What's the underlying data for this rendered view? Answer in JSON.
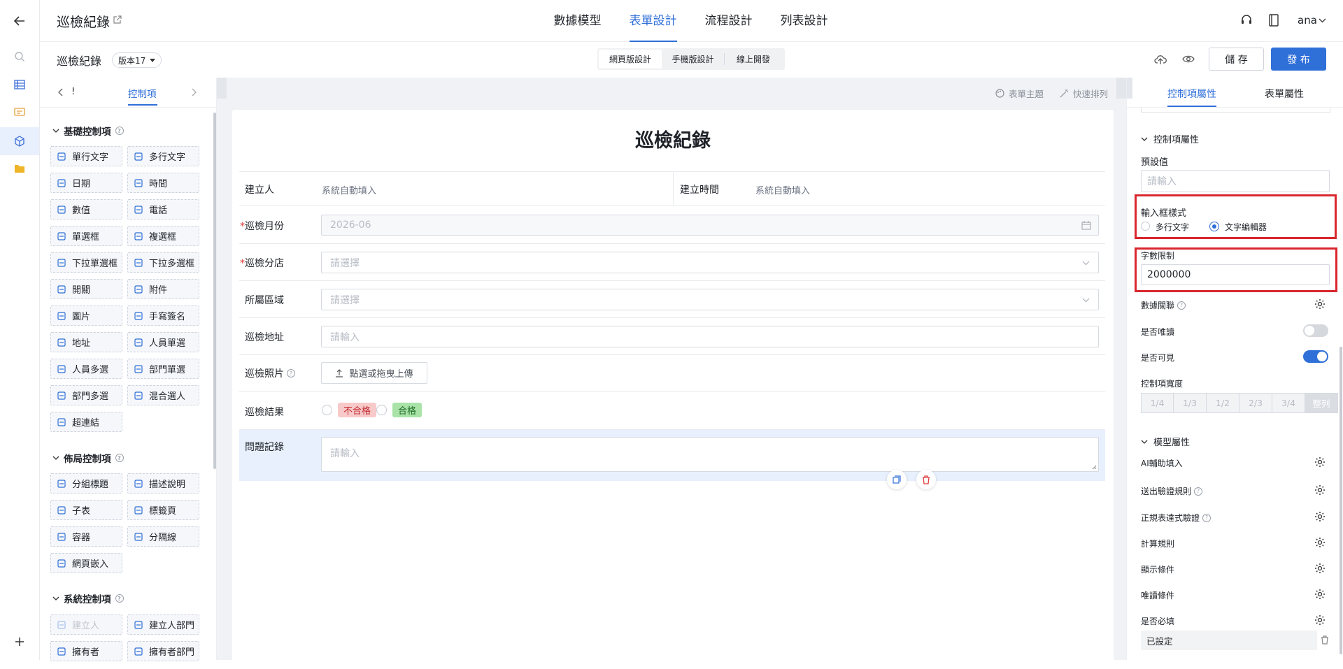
{
  "app": {
    "title": "巡檢紀錄",
    "user": "ana"
  },
  "main_tabs": [
    {
      "label": "數據模型"
    },
    {
      "label": "表單設計"
    },
    {
      "label": "流程設計"
    },
    {
      "label": "列表設計"
    }
  ],
  "subbar": {
    "form_name": "巡檢紀錄",
    "version": "版本17",
    "device_tabs": [
      "網頁版設計",
      "手機版設計",
      "線上開發"
    ],
    "save": "儲 存",
    "publish": "發 布"
  },
  "toolbox": {
    "tab_prev": "!",
    "tab_active": "控制項",
    "basic": {
      "title": "基礎控制項",
      "items": [
        "單行文字",
        "多行文字",
        "日期",
        "時間",
        "數值",
        "電話",
        "單選框",
        "複選框",
        "下拉單選框",
        "下拉多選框",
        "開關",
        "附件",
        "圖片",
        "手寫簽名",
        "地址",
        "人員單選",
        "人員多選",
        "部門單選",
        "部門多選",
        "混合選人",
        "超連結"
      ]
    },
    "layout": {
      "title": "佈局控制項",
      "items": [
        "分組標題",
        "描述說明",
        "子表",
        "標籤頁",
        "容器",
        "分隔線",
        "網頁嵌入"
      ]
    },
    "system": {
      "title": "系統控制項",
      "items": [
        "建立人",
        "建立人部門",
        "擁有者",
        "擁有者部門"
      ]
    }
  },
  "canvas": {
    "theme": "表單主題",
    "quick_arrange": "快速排列",
    "form_title": "巡檢紀錄",
    "creator_label": "建立人",
    "creator_value": "系統自動填入",
    "created_time_label": "建立時間",
    "created_time_value": "系統自動填入",
    "month_label": "巡檢月份",
    "month_value": "2026-06",
    "branch_label": "巡檢分店",
    "branch_placeholder": "請選擇",
    "region_label": "所屬區域",
    "region_placeholder": "請選擇",
    "address_label": "巡檢地址",
    "address_placeholder": "請輸入",
    "photo_label": "巡檢照片",
    "upload_label": "點選或拖曳上傳",
    "result_label": "巡檢結果",
    "result_options": [
      "不合格",
      "合格"
    ],
    "issue_label": "問題記錄",
    "issue_placeholder": "請輸入"
  },
  "props": {
    "tabs": [
      "控制項屬性",
      "表單屬性"
    ],
    "section1": "控制項屬性",
    "default_label": "預設值",
    "default_placeholder": "請輸入",
    "input_style_label": "輸入框樣式",
    "input_style_options": [
      "多行文字",
      "文字編輯器"
    ],
    "limit_label": "字數限制",
    "limit_value": "2000000",
    "data_link": "數據關聯",
    "readonly": "是否唯讀",
    "visible": "是否可見",
    "width_label": "控制項寬度",
    "widths": [
      "1/4",
      "1/3",
      "1/2",
      "2/3",
      "3/4",
      "整列"
    ],
    "section2": "模型屬性",
    "model_items": [
      "AI輔助填入",
      "送出驗證規則",
      "正規表達式驗證",
      "計算規則",
      "顯示條件",
      "唯讀條件",
      "是否必填"
    ],
    "required_value": "已設定"
  },
  "colors": {
    "accent": "#2f6fd8",
    "highlight": "#d9272e",
    "danger": "#e03d3d"
  }
}
